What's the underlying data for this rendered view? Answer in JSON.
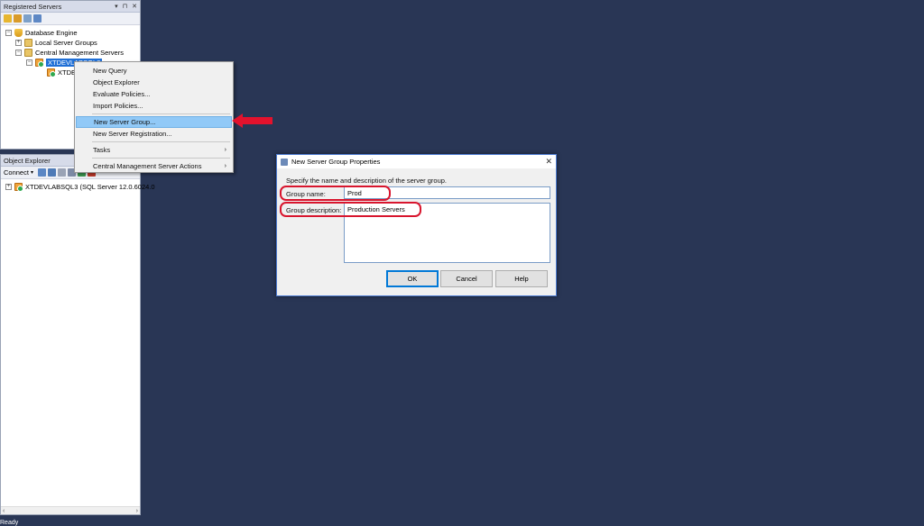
{
  "registered_servers": {
    "title": "Registered Servers",
    "controls": [
      "▾",
      "⊓",
      "✕"
    ],
    "tree": {
      "root": "Database Engine",
      "local_groups": "Local Server Groups",
      "cms": "Central Management Servers",
      "server_selected": "XTDEVLABSQL3",
      "server_child": "XTDE"
    }
  },
  "context_menu": {
    "items": [
      "New Query",
      "Object Explorer",
      "Evaluate Policies...",
      "Import Policies...",
      "New Server Group...",
      "New Server Registration...",
      "Tasks",
      "Central Management Server Actions"
    ]
  },
  "object_explorer": {
    "title": "Object Explorer",
    "connect_label": "Connect",
    "server_node": "XTDEVLABSQL3 (SQL Server 12.0.6024.0"
  },
  "dialog": {
    "title": "New Server Group Properties",
    "instruction": "Specify the name and description of the server group.",
    "group_name_label": "Group name:",
    "group_name_value": "Prod",
    "group_desc_label": "Group description:",
    "group_desc_value": "Production Servers",
    "ok": "OK",
    "cancel": "Cancel",
    "help": "Help"
  },
  "status_text": "Ready",
  "colors": {
    "background": "#293655",
    "highlight_ring": "#d8152d",
    "menu_highlight": "#91c9f7",
    "selection": "#1f6fd6"
  }
}
